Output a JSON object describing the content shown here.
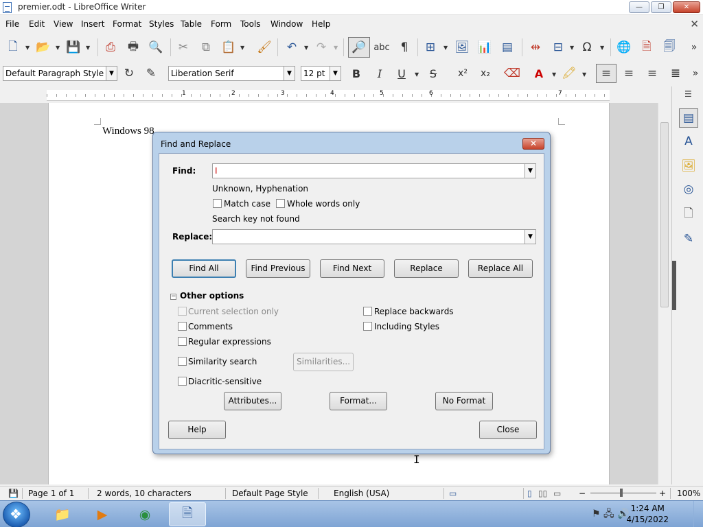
{
  "window": {
    "title": "premier.odt - LibreOffice Writer",
    "controls": [
      "—",
      "❐",
      "✕"
    ]
  },
  "menu": [
    "File",
    "Edit",
    "View",
    "Insert",
    "Format",
    "Styles",
    "Table",
    "Form",
    "Tools",
    "Window",
    "Help"
  ],
  "menu_close": "✕",
  "formatting": {
    "paragraph_style": "Default Paragraph Style",
    "font_name": "Liberation Serif",
    "font_size": "12 pt",
    "bold": "B",
    "italic": "I",
    "underline": "U",
    "strike": "S",
    "superscript": "x²",
    "subscript": "x₂"
  },
  "toolbar_icons": [
    "new-icon",
    "open-icon",
    "save-icon",
    "export-pdf-icon",
    "print-icon",
    "print-preview-icon",
    "cut-icon",
    "copy-icon",
    "paste-icon",
    "clone-formatting-icon",
    "undo-icon",
    "redo-icon",
    "find-replace-icon",
    "spelling-icon",
    "formatting-marks-icon",
    "table-icon",
    "image-icon",
    "chart-icon",
    "textbox-icon",
    "page-break-icon",
    "field-icon",
    "special-character-icon",
    "hyperlink-icon",
    "footnote-icon",
    "comment-icon"
  ],
  "ruler_numbers": [
    "1",
    "2",
    "3",
    "4",
    "5",
    "6",
    "7"
  ],
  "document": {
    "text": "Windows 98"
  },
  "dialog": {
    "title": "Find and Replace",
    "close": "✕",
    "find_label": "Find:",
    "find_value": "I",
    "find_attributes": "Unknown, Hyphenation",
    "match_case": "Match case",
    "whole_words": "Whole words only",
    "status": "Search key not found",
    "replace_label": "Replace:",
    "replace_value": "",
    "buttons": {
      "find_all": "Find All",
      "find_previous": "Find Previous",
      "find_next": "Find Next",
      "replace": "Replace",
      "replace_all": "Replace All"
    },
    "other_options": "Other options",
    "options": {
      "current_selection": "Current selection only",
      "comments": "Comments",
      "regex": "Regular expressions",
      "similarity": "Similarity search",
      "diacritic": "Diacritic-sensitive",
      "replace_backwards": "Replace backwards",
      "including_styles": "Including Styles"
    },
    "similarities": "Similarities...",
    "attributes": "Attributes...",
    "format": "Format...",
    "no_format": "No Format",
    "help": "Help",
    "close_button": "Close"
  },
  "statusbar": {
    "page": "Page 1 of 1",
    "words": "2 words, 10 characters",
    "page_style": "Default Page Style",
    "language": "English (USA)",
    "zoom": "100%"
  },
  "taskbar": {
    "time": "1:24 AM",
    "date": "4/15/2022"
  }
}
